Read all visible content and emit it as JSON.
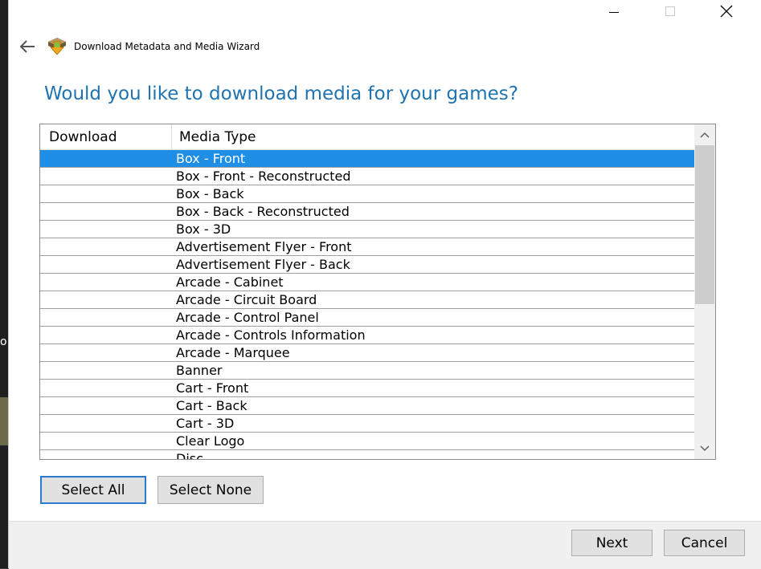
{
  "window": {
    "title": "Download Metadata and Media Wizard",
    "heading": "Would you like to download media for your games?"
  },
  "list": {
    "columns": [
      "Download",
      "Media Type"
    ],
    "selected_index": 0,
    "rows": [
      "Box - Front",
      "Box - Front - Reconstructed",
      "Box - Back",
      "Box - Back - Reconstructed",
      "Box - 3D",
      "Advertisement Flyer - Front",
      "Advertisement Flyer - Back",
      "Arcade - Cabinet",
      "Arcade - Circuit Board",
      "Arcade - Control Panel",
      "Arcade - Controls Information",
      "Arcade - Marquee",
      "Banner",
      "Cart - Front",
      "Cart - Back",
      "Cart - 3D",
      "Clear Logo",
      "Disc"
    ]
  },
  "buttons": {
    "select_all": "Select All",
    "select_none": "Select None",
    "next": "Next",
    "cancel": "Cancel"
  },
  "colors": {
    "heading": "#1e73b0",
    "selection": "#1e8ee6",
    "focus_border": "#2b7ad0"
  }
}
